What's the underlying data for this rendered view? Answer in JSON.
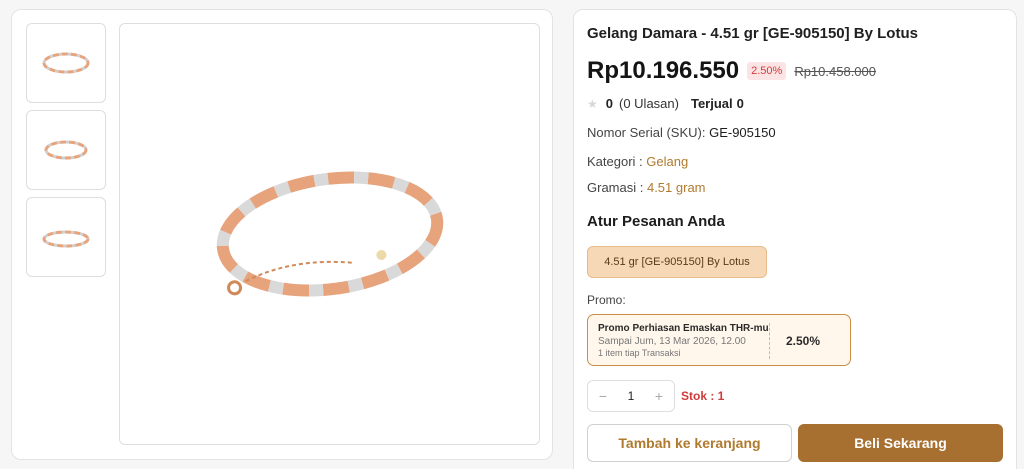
{
  "colors": {
    "accent": "#b07a2e",
    "buy_button": "#a87030",
    "variant_chip_bg": "#f6d8b6",
    "discount_red": "#d23b3b",
    "rose_gold": "#e6a37c",
    "silver": "#d9d9d9"
  },
  "gallery": {
    "thumbnails": [
      {
        "alt": "bracelet-thumbnail-1"
      },
      {
        "alt": "bracelet-thumbnail-2"
      },
      {
        "alt": "bracelet-thumbnail-3"
      }
    ],
    "main_image_icon": "bracelet-image"
  },
  "product": {
    "title": "Gelang Damara - 4.51 gr [GE-905150] By Lotus",
    "price": "Rp10.196.550",
    "discount": "2.50%",
    "old_price": "Rp10.458.000",
    "rating": "0",
    "reviews": "(0 Ulasan)",
    "sold_label": "Terjual",
    "sold_count": "0",
    "sku_label": "Nomor Serial (SKU):",
    "sku": "GE-905150",
    "category_label": "Kategori :",
    "category": "Gelang",
    "weight_label": "Gramasi :",
    "weight": "4.51 gram"
  },
  "order": {
    "section_title": "Atur Pesanan Anda",
    "variant": "4.51 gr [GE-905150] By Lotus",
    "promo_label": "Promo:",
    "promo": {
      "name": "Promo Perhiasan Emaskan THR-mu",
      "until": "Sampai Jum, 13 Mar 2026, 12.00",
      "limit": "1 item tiap Transaksi",
      "percent": "2.50%"
    },
    "quantity": "1",
    "minus_symbol": "−",
    "plus_symbol": "+",
    "stock": "Stok : 1",
    "add_to_cart": "Tambah ke keranjang",
    "buy_now": "Beli Sekarang"
  }
}
